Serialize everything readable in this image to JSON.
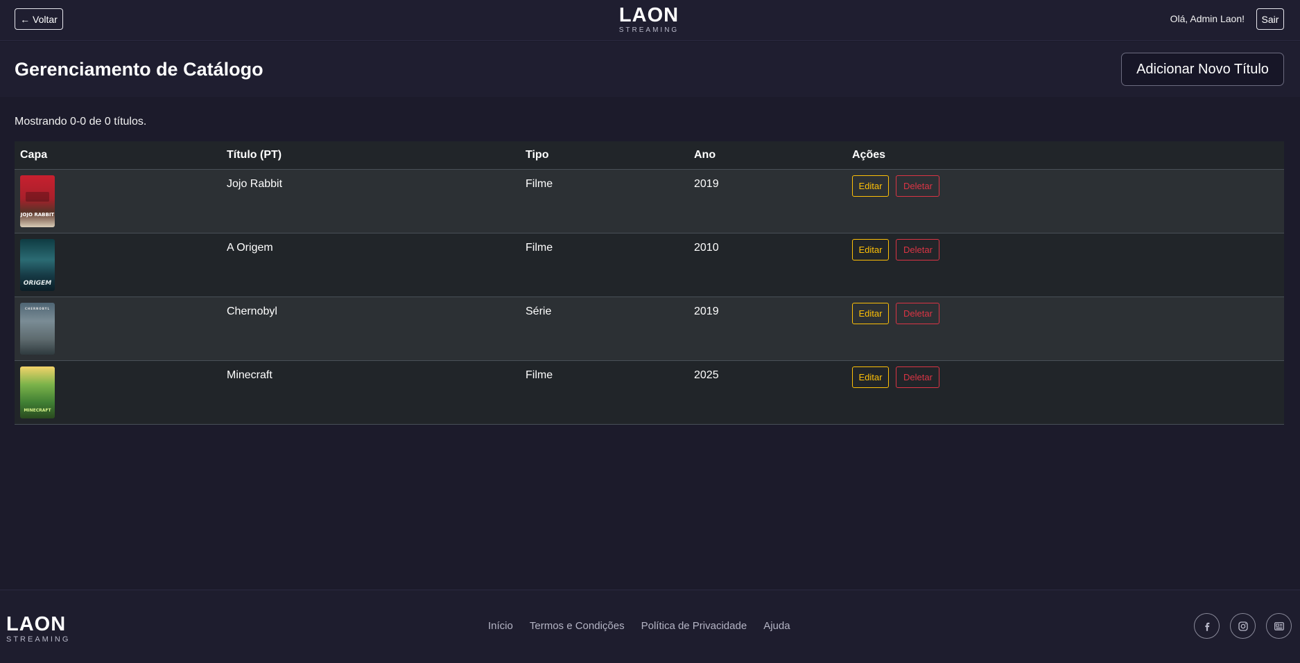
{
  "header": {
    "back_label": "← Voltar",
    "logo_main": "LAON",
    "logo_sub": "STREAMING",
    "greeting": "Olá, Admin Laon!",
    "logout_label": "Sair"
  },
  "page": {
    "title": "Gerenciamento de Catálogo",
    "add_button": "Adicionar Novo Título",
    "showing_text": "Mostrando 0-0 de 0 títulos."
  },
  "table": {
    "headers": [
      "Capa",
      "Título (PT)",
      "Tipo",
      "Ano",
      "Ações"
    ],
    "rows": [
      {
        "title": "Jojo Rabbit",
        "type": "Filme",
        "year": "2019",
        "poster_text": "JOJO RABBIT"
      },
      {
        "title": "A Origem",
        "type": "Filme",
        "year": "2010",
        "poster_text": "ORIGEM"
      },
      {
        "title": "Chernobyl",
        "type": "Série",
        "year": "2019",
        "poster_text": "CHERNOBYL"
      },
      {
        "title": "Minecraft",
        "type": "Filme",
        "year": "2025",
        "poster_text": "MINECRAFT"
      }
    ],
    "edit_label": "Editar",
    "delete_label": "Deletar"
  },
  "footer": {
    "logo_main": "LAON",
    "logo_sub": "STREAMING",
    "links": [
      "Início",
      "Termos e Condições",
      "Política de Privacidade",
      "Ajuda"
    ],
    "socials": [
      "facebook-icon",
      "instagram-icon",
      "news-icon"
    ]
  },
  "colors": {
    "background": "#1c1b2b",
    "edit": "#ffc107",
    "delete": "#dc3545"
  }
}
